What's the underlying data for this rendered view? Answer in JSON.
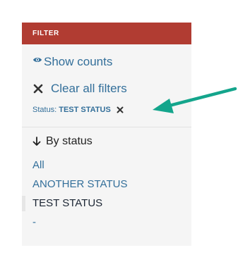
{
  "filter_panel": {
    "header": "FILTER",
    "show_counts_label": "Show counts",
    "clear_all_label": "Clear all filters",
    "active_filter": {
      "label": "Status:",
      "value": "TEST STATUS"
    },
    "by_status_label": "By status",
    "status_options": [
      "All",
      "ANOTHER STATUS",
      "TEST STATUS",
      "-"
    ],
    "selected_status": "TEST STATUS"
  },
  "colors": {
    "header_bg": "#b13c32",
    "link": "#336f9a",
    "annotation_arrow": "#14a58c"
  },
  "icons": [
    "eye-icon",
    "close-icon",
    "arrow-down-icon",
    "annotation-arrow"
  ]
}
